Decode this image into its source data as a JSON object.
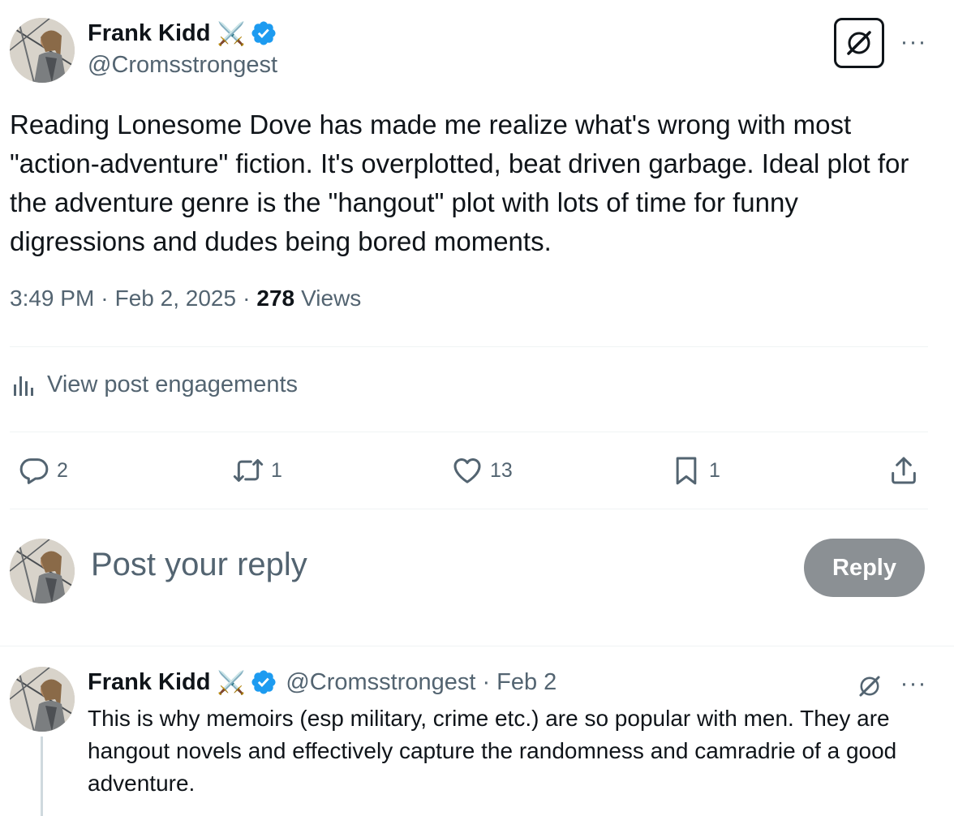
{
  "post": {
    "author": {
      "display_name": "Frank Kidd",
      "emoji": "⚔️",
      "handle": "@Cromsstrongest"
    },
    "text": "Reading Lonesome Dove has made me realize what's wrong with most \"action-adventure\" fiction. It's overplotted, beat driven garbage. Ideal plot for the adventure genre is the \"hangout\" plot with lots of time for funny digressions and dudes being bored moments.",
    "time": "3:49 PM",
    "date": "Feb 2, 2025",
    "views_count": "278",
    "views_label": "Views",
    "more_label": "···",
    "engagements_label": "View post engagements",
    "actions": {
      "replies": "2",
      "reposts": "1",
      "likes": "13",
      "bookmarks": "1"
    }
  },
  "composer": {
    "placeholder": "Post your reply",
    "button_label": "Reply"
  },
  "reply": {
    "author": {
      "display_name": "Frank Kidd",
      "emoji": "⚔️",
      "handle": "@Cromsstrongest"
    },
    "date": "Feb 2",
    "dot": "·",
    "text": "This is why memoirs (esp military, crime etc.) are so popular with men. They are hangout novels and effectively capture the randomness and camradrie of a good adventure.",
    "more_label": "···"
  },
  "colors": {
    "verified": "#1d9bf0",
    "text_primary": "#0f1419",
    "text_secondary": "#536471",
    "reply_button": "#8b9094"
  },
  "icons": [
    "grok-icon",
    "more-icon",
    "verified-icon",
    "analytics-icon",
    "reply-icon",
    "repost-icon",
    "like-icon",
    "bookmark-icon",
    "share-icon"
  ]
}
